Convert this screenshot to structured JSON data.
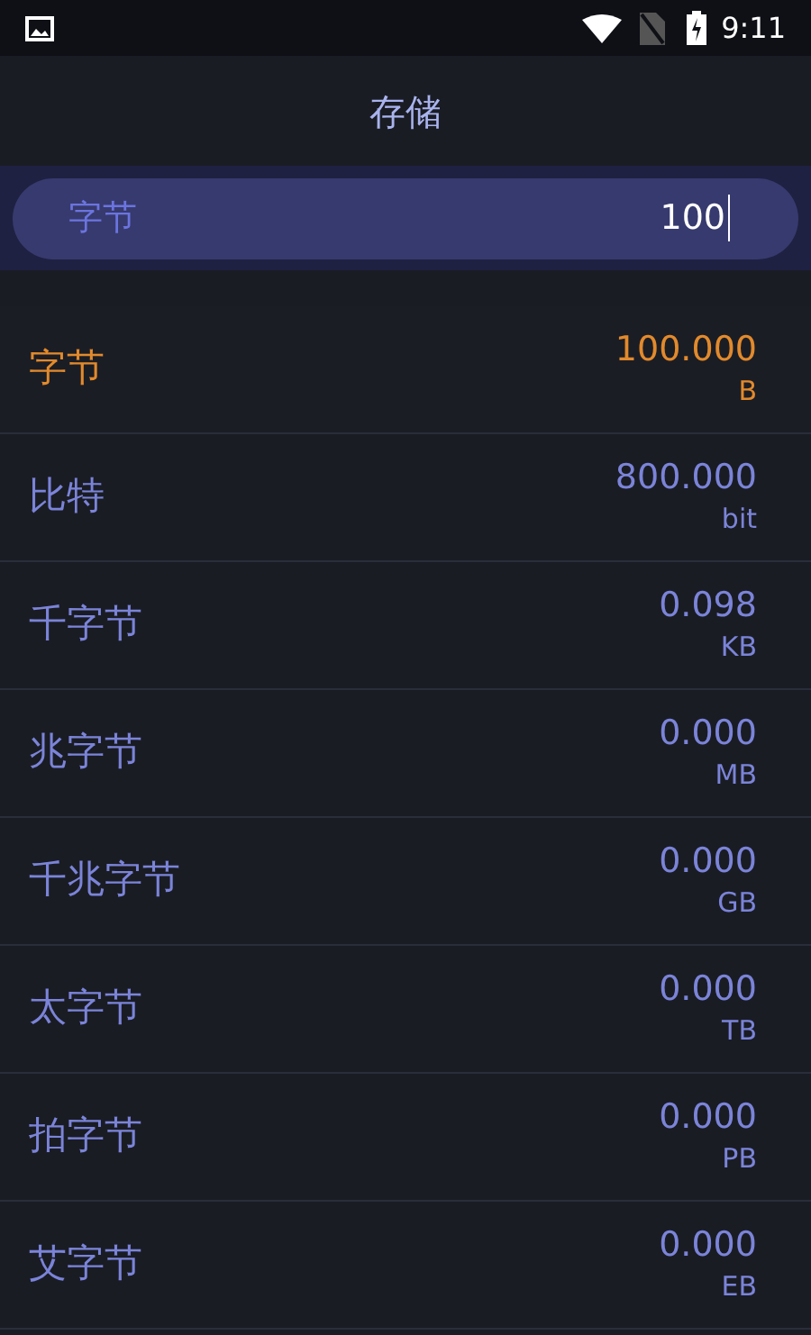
{
  "status_bar": {
    "time": "9:11"
  },
  "title": "存储",
  "input": {
    "unit": "字节",
    "value": "100"
  },
  "units": [
    {
      "name": "字节",
      "value": "100.000",
      "symbol": "B",
      "selected": true
    },
    {
      "name": "比特",
      "value": "800.000",
      "symbol": "bit",
      "selected": false
    },
    {
      "name": "千字节",
      "value": "0.098",
      "symbol": "KB",
      "selected": false
    },
    {
      "name": "兆字节",
      "value": "0.000",
      "symbol": "MB",
      "selected": false
    },
    {
      "name": "千兆字节",
      "value": "0.000",
      "symbol": "GB",
      "selected": false
    },
    {
      "name": "太字节",
      "value": "0.000",
      "symbol": "TB",
      "selected": false
    },
    {
      "name": "拍字节",
      "value": "0.000",
      "symbol": "PB",
      "selected": false
    },
    {
      "name": "艾字节",
      "value": "0.000",
      "symbol": "EB",
      "selected": false
    }
  ]
}
